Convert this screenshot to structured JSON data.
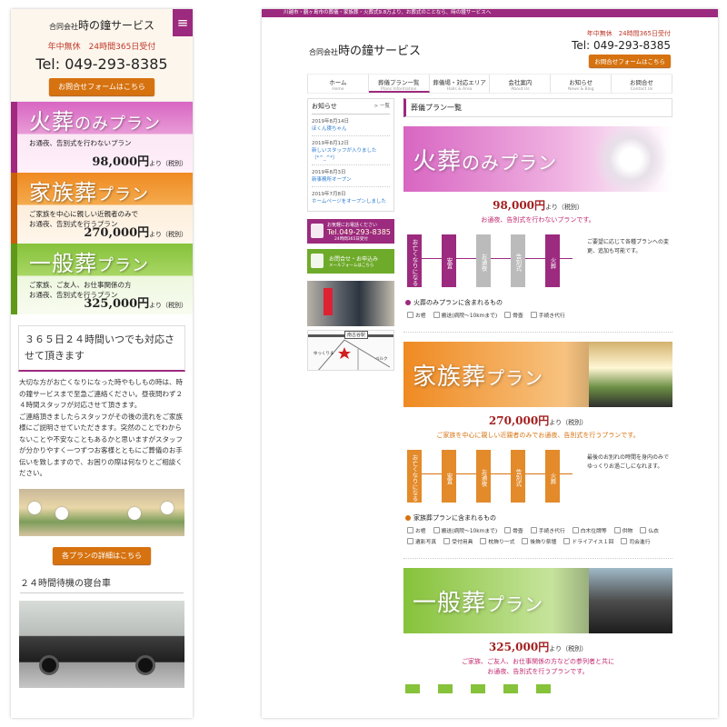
{
  "company": {
    "prefix": "合同会社",
    "name": "時の鐘サービス"
  },
  "hours": "年中無休　24時間365日受付",
  "tel": "Tel: 049-293-8385",
  "contact_btn": "お問合せフォームはこちら",
  "menu_icon": "≡",
  "colors": {
    "brand": "#9c2a7e",
    "orange": "#d6720f",
    "green": "#86c23a"
  },
  "mobile": {
    "plans": [
      {
        "title_a": "火葬",
        "title_b": "のみプラン",
        "desc": [
          "お通夜、告別式を行わないプラン"
        ],
        "price": "98,000円",
        "unit": "より（税別）"
      },
      {
        "title_a": "家族葬",
        "title_b": "プラン",
        "desc": [
          "ご家族を中心に親しい近親者のみで",
          "お通夜、告別式を行うプラン"
        ],
        "price": "270,000円",
        "unit": "より（税別）"
      },
      {
        "title_a": "一般葬",
        "title_b": "プラン",
        "desc": [
          "ご家族、ご友人、お仕事関係の方",
          "お通夜、告別式を行うプラン"
        ],
        "price": "325,000円",
        "unit": "より（税別）"
      }
    ],
    "heading_24": "３６５日２４時間いつでも対応させて頂きます",
    "body": [
      "大切な方がお亡くなりになった時やもしもの時は、時の鐘サービスまで至急ご連絡ください。昼夜問わず２４時間スタッフが対応させて頂きます。",
      "ご連絡頂きましたらスタッフがその後の流れをご家族様にご説明させていただきます。突然のことでわからないことや不安なこともあるかと思いますがスタッフが分かりやすく一つずつお客様とともにご葬儀のお手伝いを致しますので、お困りの際は何なりとご相談ください。"
    ],
    "detail_btn": "各プランの詳細はこちら",
    "car_title": "２４時間待機の寝台車"
  },
  "desktop": {
    "topbar": "川越市・鶴ヶ島市の葬儀・家族葬・火葬式9.8万より、お葬式のことなら、時の鐘サービスへ",
    "contact_btn": "お問合せフォームはこちら",
    "nav": [
      {
        "label": "ホーム",
        "en": "Home"
      },
      {
        "label": "葬儀プラン一覧",
        "en": "Plans Information"
      },
      {
        "label": "葬儀場・対応エリア",
        "en": "Halls & Area"
      },
      {
        "label": "会社案内",
        "en": "About Us"
      },
      {
        "label": "お知らせ",
        "en": "News & Blog"
      },
      {
        "label": "お問合せ",
        "en": "Contact Us"
      }
    ],
    "news": {
      "title": "お知らせ",
      "more": "> 一覧",
      "items": [
        {
          "date": "2019年8月14日",
          "text": "ほくん寝ちゃん"
        },
        {
          "date": "2019年8月12日",
          "text": "新しいスタッフが入りました（*^_^*）"
        },
        {
          "date": "2019年8月3日",
          "text": "新事務所オープン"
        },
        {
          "date": "2019年7月8日",
          "text": "ホームページをオープンしました"
        }
      ]
    },
    "side_tel": {
      "line1": "お気軽にお電話ください",
      "tel": "Tel.049-293-8385",
      "line3": "24時間365日受付"
    },
    "side_mail": {
      "line1": "お問合せ・お申込み",
      "line2": "メールフォームはこちら"
    },
    "map_labels": {
      "station": "南古谷駅",
      "shop": "ゆっくりま",
      "store": "ベルク"
    },
    "main_title": "葬儀プラン一覧",
    "plans": [
      {
        "title_a": "火葬",
        "title_b": "のみプラン",
        "price": "98,000円",
        "unit": "より（税別）",
        "sub": [
          "お通夜、告別式を行わないプランです。"
        ],
        "steps": [
          "お亡くなりになる",
          "安置",
          "お通夜",
          "告別式",
          "火葬"
        ],
        "note": "ご要望に応じて各種プランへの変更、追加も可能です。",
        "inc_title": "火葬のみプランに含まれるもの",
        "items": [
          "お棺",
          "搬送(病院〜10kmまで)",
          "骨壺",
          "手続き代行"
        ]
      },
      {
        "title_a": "家族葬",
        "title_b": "プラン",
        "price": "270,000円",
        "unit": "より（税別）",
        "sub": [
          "ご家族を中心に親しい近親者のみでお通夜、告別式を行うプランです。"
        ],
        "steps": [
          "お亡くなりになる",
          "安置",
          "お通夜",
          "告別式",
          "火葬"
        ],
        "note": "最後のお別れの時間を身内のみでゆっくりお過ごしになれます。",
        "inc_title": "家族葬プランに含まれるもの",
        "items": [
          "お棺",
          "搬送(病院〜10kmまで)",
          "骨壺",
          "手続き代行",
          "白木位牌等",
          "供物",
          "仏衣",
          "遺影写真",
          "受付用具",
          "枕飾り一式",
          "後飾り祭壇",
          "ドライアイス１回",
          "司会進行"
        ]
      },
      {
        "title_a": "一般葬",
        "title_b": "プラン",
        "price": "325,000円",
        "unit": "より（税別）",
        "sub": [
          "ご家族、ご友人、お仕事関係の方などの参列者と共に",
          "お通夜、告別式を行うプランです。"
        ]
      }
    ]
  }
}
